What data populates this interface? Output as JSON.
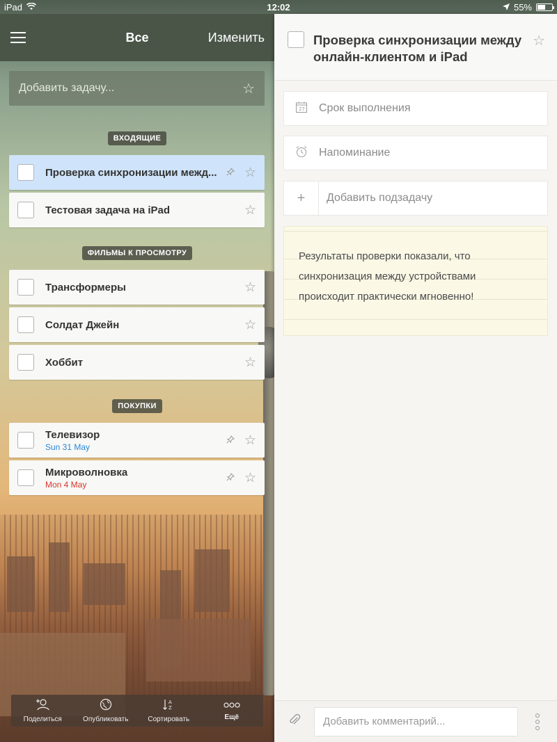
{
  "status_bar": {
    "carrier": "iPad",
    "time": "12:02",
    "battery": "55%",
    "battery_level": 0.55
  },
  "header": {
    "title": "Все",
    "edit_label": "Изменить"
  },
  "add_task": {
    "placeholder": "Добавить задачу..."
  },
  "sections": [
    {
      "label": "ВХОДЯЩИЕ",
      "tasks": [
        {
          "name": "Проверка синхронизации межд...",
          "selected": true,
          "pinned": true
        },
        {
          "name": "Тестовая задача на iPad"
        }
      ]
    },
    {
      "label": "ФИЛЬМЫ К ПРОСМОТРУ",
      "tasks": [
        {
          "name": "Трансформеры"
        },
        {
          "name": "Солдат Джейн"
        },
        {
          "name": "Хоббит"
        }
      ]
    },
    {
      "label": "ПОКУПКИ",
      "tasks": [
        {
          "name": "Телевизор",
          "due": "Sun 31 May",
          "due_color": "#2b88d9",
          "pinned": true
        },
        {
          "name": "Микроволновка",
          "due": "Mon 4 May",
          "due_color": "#d9362b",
          "pinned": true
        }
      ]
    }
  ],
  "toolbar": {
    "share": "Поделиться",
    "publish": "Опубликовать",
    "sort": "Сортировать",
    "more": "Ещё"
  },
  "detail": {
    "title": "Проверка синхронизации между онлайн-клиентом и iPad",
    "due_date_label": "Срок выполнения",
    "reminder_label": "Напоминание",
    "add_subtask_label": "Добавить подзадачу",
    "note": "Результаты проверки показали, что синхронизация между устройствами происходит практически мгновенно!",
    "comment_placeholder": "Добавить комментарий...",
    "calendar_day": "27"
  }
}
